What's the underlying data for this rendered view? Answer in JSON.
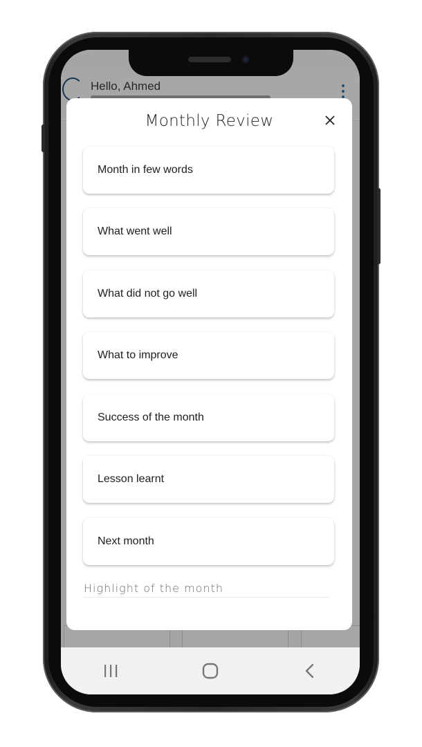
{
  "app": {
    "greeting": "Hello, Ahmed"
  },
  "modal": {
    "title": "Monthly Review",
    "fields": [
      {
        "label": "Month in few words"
      },
      {
        "label": "What went well"
      },
      {
        "label": "What did not go well"
      },
      {
        "label": "What to improve"
      },
      {
        "label": "Success of the month"
      },
      {
        "label": "Lesson learnt"
      },
      {
        "label": "Next month"
      }
    ],
    "partial_field_label": "Highlight of the month"
  },
  "icons": {
    "close": "close-icon",
    "menu": "kebab-menu-icon",
    "nav_recents": "recents-icon",
    "nav_home": "home-icon",
    "nav_back": "back-icon"
  },
  "colors": {
    "accent": "#3a6fb0",
    "modal_bg": "#ffffff",
    "overlay": "rgba(0,0,0,0.32)"
  }
}
